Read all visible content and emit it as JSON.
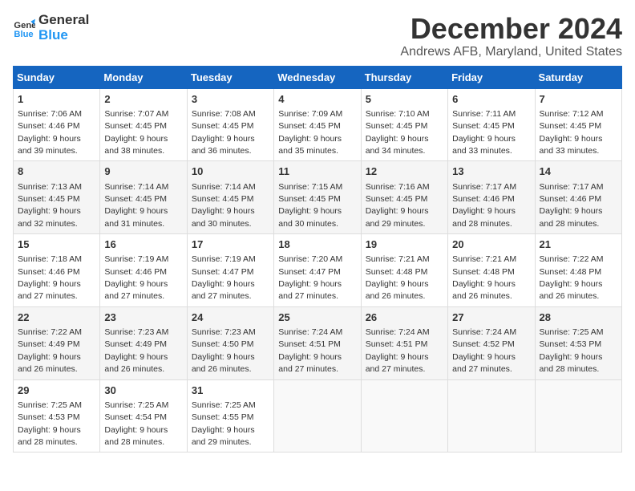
{
  "header": {
    "logo_line1": "General",
    "logo_line2": "Blue",
    "month": "December 2024",
    "location": "Andrews AFB, Maryland, United States"
  },
  "weekdays": [
    "Sunday",
    "Monday",
    "Tuesday",
    "Wednesday",
    "Thursday",
    "Friday",
    "Saturday"
  ],
  "weeks": [
    [
      {
        "day": "1",
        "sunrise": "Sunrise: 7:06 AM",
        "sunset": "Sunset: 4:46 PM",
        "daylight": "Daylight: 9 hours and 39 minutes."
      },
      {
        "day": "2",
        "sunrise": "Sunrise: 7:07 AM",
        "sunset": "Sunset: 4:45 PM",
        "daylight": "Daylight: 9 hours and 38 minutes."
      },
      {
        "day": "3",
        "sunrise": "Sunrise: 7:08 AM",
        "sunset": "Sunset: 4:45 PM",
        "daylight": "Daylight: 9 hours and 36 minutes."
      },
      {
        "day": "4",
        "sunrise": "Sunrise: 7:09 AM",
        "sunset": "Sunset: 4:45 PM",
        "daylight": "Daylight: 9 hours and 35 minutes."
      },
      {
        "day": "5",
        "sunrise": "Sunrise: 7:10 AM",
        "sunset": "Sunset: 4:45 PM",
        "daylight": "Daylight: 9 hours and 34 minutes."
      },
      {
        "day": "6",
        "sunrise": "Sunrise: 7:11 AM",
        "sunset": "Sunset: 4:45 PM",
        "daylight": "Daylight: 9 hours and 33 minutes."
      },
      {
        "day": "7",
        "sunrise": "Sunrise: 7:12 AM",
        "sunset": "Sunset: 4:45 PM",
        "daylight": "Daylight: 9 hours and 33 minutes."
      }
    ],
    [
      {
        "day": "8",
        "sunrise": "Sunrise: 7:13 AM",
        "sunset": "Sunset: 4:45 PM",
        "daylight": "Daylight: 9 hours and 32 minutes."
      },
      {
        "day": "9",
        "sunrise": "Sunrise: 7:14 AM",
        "sunset": "Sunset: 4:45 PM",
        "daylight": "Daylight: 9 hours and 31 minutes."
      },
      {
        "day": "10",
        "sunrise": "Sunrise: 7:14 AM",
        "sunset": "Sunset: 4:45 PM",
        "daylight": "Daylight: 9 hours and 30 minutes."
      },
      {
        "day": "11",
        "sunrise": "Sunrise: 7:15 AM",
        "sunset": "Sunset: 4:45 PM",
        "daylight": "Daylight: 9 hours and 30 minutes."
      },
      {
        "day": "12",
        "sunrise": "Sunrise: 7:16 AM",
        "sunset": "Sunset: 4:45 PM",
        "daylight": "Daylight: 9 hours and 29 minutes."
      },
      {
        "day": "13",
        "sunrise": "Sunrise: 7:17 AM",
        "sunset": "Sunset: 4:46 PM",
        "daylight": "Daylight: 9 hours and 28 minutes."
      },
      {
        "day": "14",
        "sunrise": "Sunrise: 7:17 AM",
        "sunset": "Sunset: 4:46 PM",
        "daylight": "Daylight: 9 hours and 28 minutes."
      }
    ],
    [
      {
        "day": "15",
        "sunrise": "Sunrise: 7:18 AM",
        "sunset": "Sunset: 4:46 PM",
        "daylight": "Daylight: 9 hours and 27 minutes."
      },
      {
        "day": "16",
        "sunrise": "Sunrise: 7:19 AM",
        "sunset": "Sunset: 4:46 PM",
        "daylight": "Daylight: 9 hours and 27 minutes."
      },
      {
        "day": "17",
        "sunrise": "Sunrise: 7:19 AM",
        "sunset": "Sunset: 4:47 PM",
        "daylight": "Daylight: 9 hours and 27 minutes."
      },
      {
        "day": "18",
        "sunrise": "Sunrise: 7:20 AM",
        "sunset": "Sunset: 4:47 PM",
        "daylight": "Daylight: 9 hours and 27 minutes."
      },
      {
        "day": "19",
        "sunrise": "Sunrise: 7:21 AM",
        "sunset": "Sunset: 4:48 PM",
        "daylight": "Daylight: 9 hours and 26 minutes."
      },
      {
        "day": "20",
        "sunrise": "Sunrise: 7:21 AM",
        "sunset": "Sunset: 4:48 PM",
        "daylight": "Daylight: 9 hours and 26 minutes."
      },
      {
        "day": "21",
        "sunrise": "Sunrise: 7:22 AM",
        "sunset": "Sunset: 4:48 PM",
        "daylight": "Daylight: 9 hours and 26 minutes."
      }
    ],
    [
      {
        "day": "22",
        "sunrise": "Sunrise: 7:22 AM",
        "sunset": "Sunset: 4:49 PM",
        "daylight": "Daylight: 9 hours and 26 minutes."
      },
      {
        "day": "23",
        "sunrise": "Sunrise: 7:23 AM",
        "sunset": "Sunset: 4:49 PM",
        "daylight": "Daylight: 9 hours and 26 minutes."
      },
      {
        "day": "24",
        "sunrise": "Sunrise: 7:23 AM",
        "sunset": "Sunset: 4:50 PM",
        "daylight": "Daylight: 9 hours and 26 minutes."
      },
      {
        "day": "25",
        "sunrise": "Sunrise: 7:24 AM",
        "sunset": "Sunset: 4:51 PM",
        "daylight": "Daylight: 9 hours and 27 minutes."
      },
      {
        "day": "26",
        "sunrise": "Sunrise: 7:24 AM",
        "sunset": "Sunset: 4:51 PM",
        "daylight": "Daylight: 9 hours and 27 minutes."
      },
      {
        "day": "27",
        "sunrise": "Sunrise: 7:24 AM",
        "sunset": "Sunset: 4:52 PM",
        "daylight": "Daylight: 9 hours and 27 minutes."
      },
      {
        "day": "28",
        "sunrise": "Sunrise: 7:25 AM",
        "sunset": "Sunset: 4:53 PM",
        "daylight": "Daylight: 9 hours and 28 minutes."
      }
    ],
    [
      {
        "day": "29",
        "sunrise": "Sunrise: 7:25 AM",
        "sunset": "Sunset: 4:53 PM",
        "daylight": "Daylight: 9 hours and 28 minutes."
      },
      {
        "day": "30",
        "sunrise": "Sunrise: 7:25 AM",
        "sunset": "Sunset: 4:54 PM",
        "daylight": "Daylight: 9 hours and 28 minutes."
      },
      {
        "day": "31",
        "sunrise": "Sunrise: 7:25 AM",
        "sunset": "Sunset: 4:55 PM",
        "daylight": "Daylight: 9 hours and 29 minutes."
      },
      null,
      null,
      null,
      null
    ]
  ]
}
